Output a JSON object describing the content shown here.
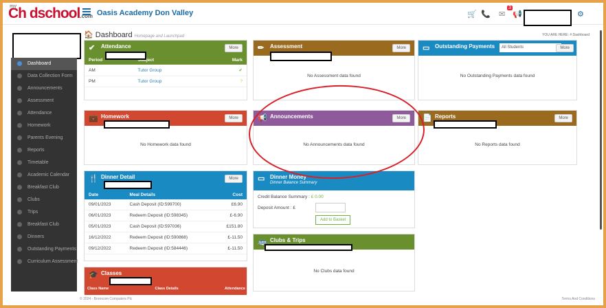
{
  "header": {
    "logo": "Ch dschool",
    "logo_prefix": "my",
    "logo_suffix": ".com",
    "school": "Oasis Academy Don Valley",
    "notif_count": "3"
  },
  "breadcrumb": {
    "title": "Dashboard",
    "subtitle": "Homepage and Launchpad",
    "you_are_here": "YOU ARE HERE: # Dashboard"
  },
  "sidebar": {
    "items": [
      "Dashboard",
      "Data Collection Form",
      "Announcements",
      "Assessment",
      "Attendance",
      "Homework",
      "Parents Evening",
      "Reports",
      "Timetable",
      "Academic Calendar",
      "Breakfast Club",
      "Clubs",
      "Trips",
      "Breakfast Club",
      "Dinners",
      "Outstanding Payments",
      "Curriculum Assessment"
    ]
  },
  "attendance": {
    "title": "Attendance",
    "more": "More",
    "cols": [
      "Period",
      "Subject",
      "Mark"
    ],
    "rows": [
      [
        "AM",
        "Tutor Group"
      ],
      [
        "PM",
        "Tutor Group"
      ]
    ]
  },
  "assessment": {
    "title": "Assessment",
    "more": "More",
    "nodata": "No Assessment data found"
  },
  "payments": {
    "title": "Outstanding Payments",
    "select": "All Students",
    "more": "More",
    "nodata": "No Outstanding Payments data found"
  },
  "homework": {
    "title": "Homework",
    "more": "More",
    "nodata": "No Homework data found"
  },
  "announcements": {
    "title": "Announcements",
    "more": "More",
    "nodata": "No Announcements data found"
  },
  "reports": {
    "title": "Reports",
    "more": "More",
    "nodata": "No Reports data found"
  },
  "dinner": {
    "title": "Dinner Detail",
    "more": "More",
    "cols": [
      "Date",
      "Meal Details",
      "Cost"
    ],
    "rows": [
      [
        "09/01/2023",
        "Cash Deposit (ID:599700)",
        "£6.90"
      ],
      [
        "06/01/2023",
        "Redeem Deposit (ID:598345)",
        "£-6.90"
      ],
      [
        "05/01/2023",
        "Cash Deposit (ID:597036)",
        "£151.80"
      ],
      [
        "16/12/2022",
        "Redeem Deposit (ID:590868)",
        "£-11.50"
      ],
      [
        "09/12/2022",
        "Redeem Deposit (ID:584446)",
        "£-11.50"
      ]
    ]
  },
  "money": {
    "title": "Dinner Money",
    "subtitle": "Dinner Balance Summary",
    "credit_label": "Credit Balance Summary :",
    "credit_value": "£ 0.00",
    "deposit_label": "Deposit Amount : £",
    "button": "Add to Basket"
  },
  "clubs": {
    "title": "Clubs & Trips",
    "nodata": "No Clubs data found"
  },
  "classes": {
    "title": "Classes",
    "cols": [
      "Class Name",
      "Class Details",
      "Attendance"
    ]
  },
  "footer": {
    "copyright": "© 2024 - Bromcom Computers Plc",
    "terms": "Terms And Conditions"
  },
  "colors": {
    "green": "#6a8f2e",
    "orange": "#9a6b1e",
    "blue": "#1a8ac3",
    "red": "#d2472f",
    "purple": "#8e5a9b",
    "darkblue": "#2a7fb0"
  }
}
